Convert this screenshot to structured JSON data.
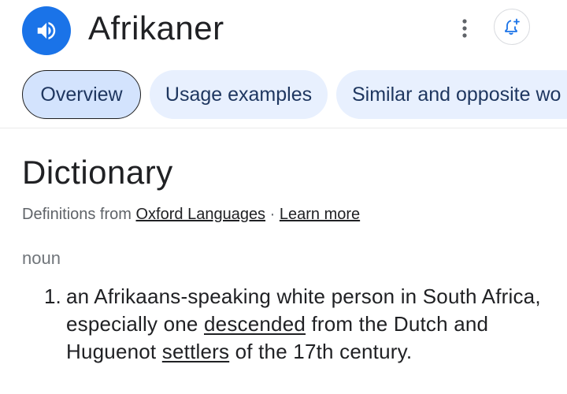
{
  "header": {
    "word": "Afrikaner",
    "audio_icon": "speaker-icon",
    "more_icon": "more-vert-icon",
    "alert_icon": "bell-plus-icon"
  },
  "tabs": [
    {
      "label": "Overview",
      "active": true
    },
    {
      "label": "Usage examples",
      "active": false
    },
    {
      "label": "Similar and opposite wo",
      "active": false
    }
  ],
  "dictionary": {
    "title": "Dictionary",
    "source_prefix": "Definitions from",
    "source_link": "Oxford Languages",
    "separator": "·",
    "learn_more": "Learn more",
    "part_of_speech": "noun",
    "definitions": [
      {
        "number": "1.",
        "text_before": "an Afrikaans-speaking white person in South Africa, especially one ",
        "link1": "descended",
        "text_middle": " from the Dutch and Huguenot ",
        "link2": "settlers",
        "text_after": " of the 17th century."
      }
    ]
  },
  "colors": {
    "accent": "#1a73e8",
    "chip_bg": "#e8f0fe",
    "chip_active_bg": "#d3e3fd"
  }
}
